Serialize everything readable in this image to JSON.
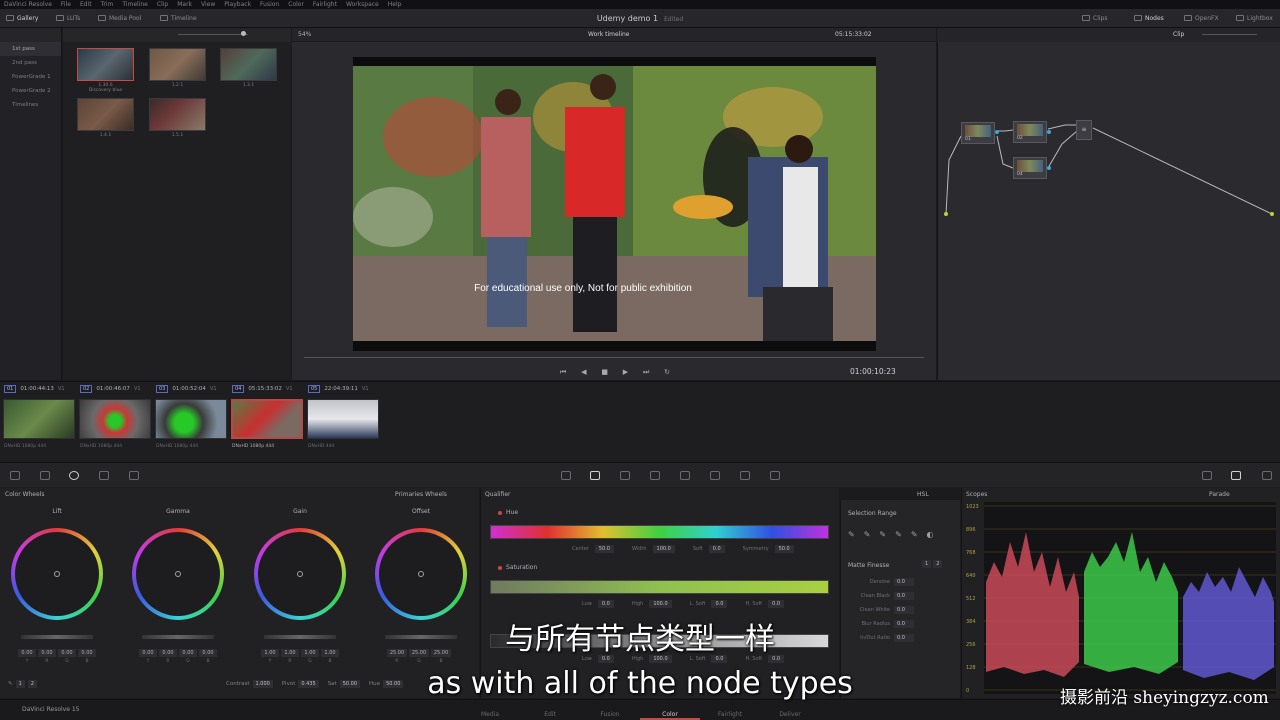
{
  "menubar": [
    "DaVinci Resolve",
    "File",
    "Edit",
    "Trim",
    "Timeline",
    "Clip",
    "Mark",
    "View",
    "Playback",
    "Fusion",
    "Color",
    "Fairlight",
    "Workspace",
    "Help"
  ],
  "topbar": {
    "gallery": "Gallery",
    "luts": "LUTs",
    "media_pool": "Media Pool",
    "timeline": "Timeline",
    "project_title": "Udemy demo 1",
    "edited": "Edited",
    "clips": "Clips",
    "nodes": "Nodes",
    "openfx": "OpenFX",
    "lightbox": "Lightbox"
  },
  "still_groups": [
    "1st pass",
    "2nd pass",
    "PowerGrade 1",
    "PowerGrade 2",
    "Timelines"
  ],
  "stills": [
    {
      "label": "1.30.6\nDiscovery blue"
    },
    {
      "label": "1.2.1"
    },
    {
      "label": "1.3.1"
    },
    {
      "label": "1.4.1"
    },
    {
      "label": "1.5.1"
    }
  ],
  "viewer": {
    "zoom": "54%",
    "timeline_name": "Work timeline",
    "source_tc": "05:15:33:02",
    "current_tc": "01:00:10:23",
    "burnin": "For educational use only, Not for public exhibition"
  },
  "node_editor": {
    "mode": "Clip",
    "nodes": [
      "01",
      "02",
      "04"
    ]
  },
  "clips": [
    {
      "num": "01",
      "tc": "01:00:44:13",
      "track": "V1",
      "codec": "DNxHD 1080p 444"
    },
    {
      "num": "02",
      "tc": "01:00:46:07",
      "track": "V1",
      "codec": "DNxHD 1080p 444"
    },
    {
      "num": "03",
      "tc": "01:00:52:04",
      "track": "V1",
      "codec": "DNxHD 1080p 444"
    },
    {
      "num": "04",
      "tc": "05:15:33:02",
      "track": "V1",
      "codec": "DNxHD 1080p 444"
    },
    {
      "num": "05",
      "tc": "22:04:39:11",
      "track": "V1",
      "codec": "DNxHD 444"
    }
  ],
  "color_wheels": {
    "title": "Color Wheels",
    "mode": "Primaries Wheels",
    "wheels": [
      {
        "name": "Lift",
        "values": [
          "0.00",
          "0.00",
          "0.00",
          "0.00"
        ],
        "labels": [
          "Y",
          "R",
          "G",
          "B"
        ]
      },
      {
        "name": "Gamma",
        "values": [
          "0.00",
          "0.00",
          "0.00",
          "0.00"
        ],
        "labels": [
          "Y",
          "R",
          "G",
          "B"
        ]
      },
      {
        "name": "Gain",
        "values": [
          "1.00",
          "1.00",
          "1.00",
          "1.00"
        ],
        "labels": [
          "Y",
          "R",
          "G",
          "B"
        ]
      },
      {
        "name": "Offset",
        "values": [
          "25.00",
          "25.00",
          "25.00"
        ],
        "labels": [
          "R",
          "G",
          "B"
        ]
      }
    ],
    "adjust": {
      "page_a": "1",
      "page_b": "2",
      "contrast_label": "Contrast",
      "contrast": "1.000",
      "pivot_label": "Pivot",
      "pivot": "0.435",
      "sat_label": "Sat",
      "sat": "50.00",
      "hue_label": "Hue",
      "hue": "50.00"
    }
  },
  "qualifier": {
    "title": "Qualifier",
    "mode": "HSL",
    "hue": {
      "label": "Hue",
      "center_label": "Center",
      "center": "50.0",
      "width_label": "Width",
      "width": "100.0",
      "soft_label": "Soft",
      "soft": "0.0",
      "sym_label": "Symmetry",
      "sym": "50.0"
    },
    "saturation": {
      "label": "Saturation",
      "low_label": "Low",
      "low": "0.0",
      "high_label": "High",
      "high": "100.0",
      "lsoft_label": "L. Soft",
      "lsoft": "0.0",
      "hsoft_label": "H. Soft",
      "hsoft": "0.0"
    },
    "luminance": {
      "low_label": "Low",
      "low": "0.0",
      "high_label": "High",
      "high": "100.0",
      "lsoft_label": "L. Soft",
      "lsoft": "0.0",
      "hsoft_label": "H. Soft",
      "hsoft": "0.0"
    }
  },
  "selection_range": {
    "title": "Selection Range",
    "matte_title": "Matte Finesse",
    "page_a": "1",
    "page_b": "2",
    "rows": [
      {
        "label": "Denoise",
        "value": "0.0"
      },
      {
        "label": "Clean Black",
        "value": "0.0"
      },
      {
        "label": "Clean White",
        "value": "0.0"
      },
      {
        "label": "Blur Radius",
        "value": "0.0"
      },
      {
        "label": "In/Out Ratio",
        "value": "0.0"
      }
    ]
  },
  "scopes": {
    "title": "Scopes",
    "mode": "Parade",
    "scale": [
      "1023",
      "896",
      "768",
      "640",
      "512",
      "384",
      "256",
      "128",
      "0"
    ]
  },
  "pages": [
    "Media",
    "Edit",
    "Fusion",
    "Color",
    "Fairlight",
    "Deliver"
  ],
  "app_name": "DaVinci Resolve 15",
  "subtitle_cn": "与所有节点类型一样",
  "subtitle_en": "as with all of the node types",
  "watermark": "摄影前沿 sheyingzyz.com",
  "colors": {
    "accent_red": "#c84848",
    "selection": "#b84848",
    "bg": "#1b1b1d"
  }
}
